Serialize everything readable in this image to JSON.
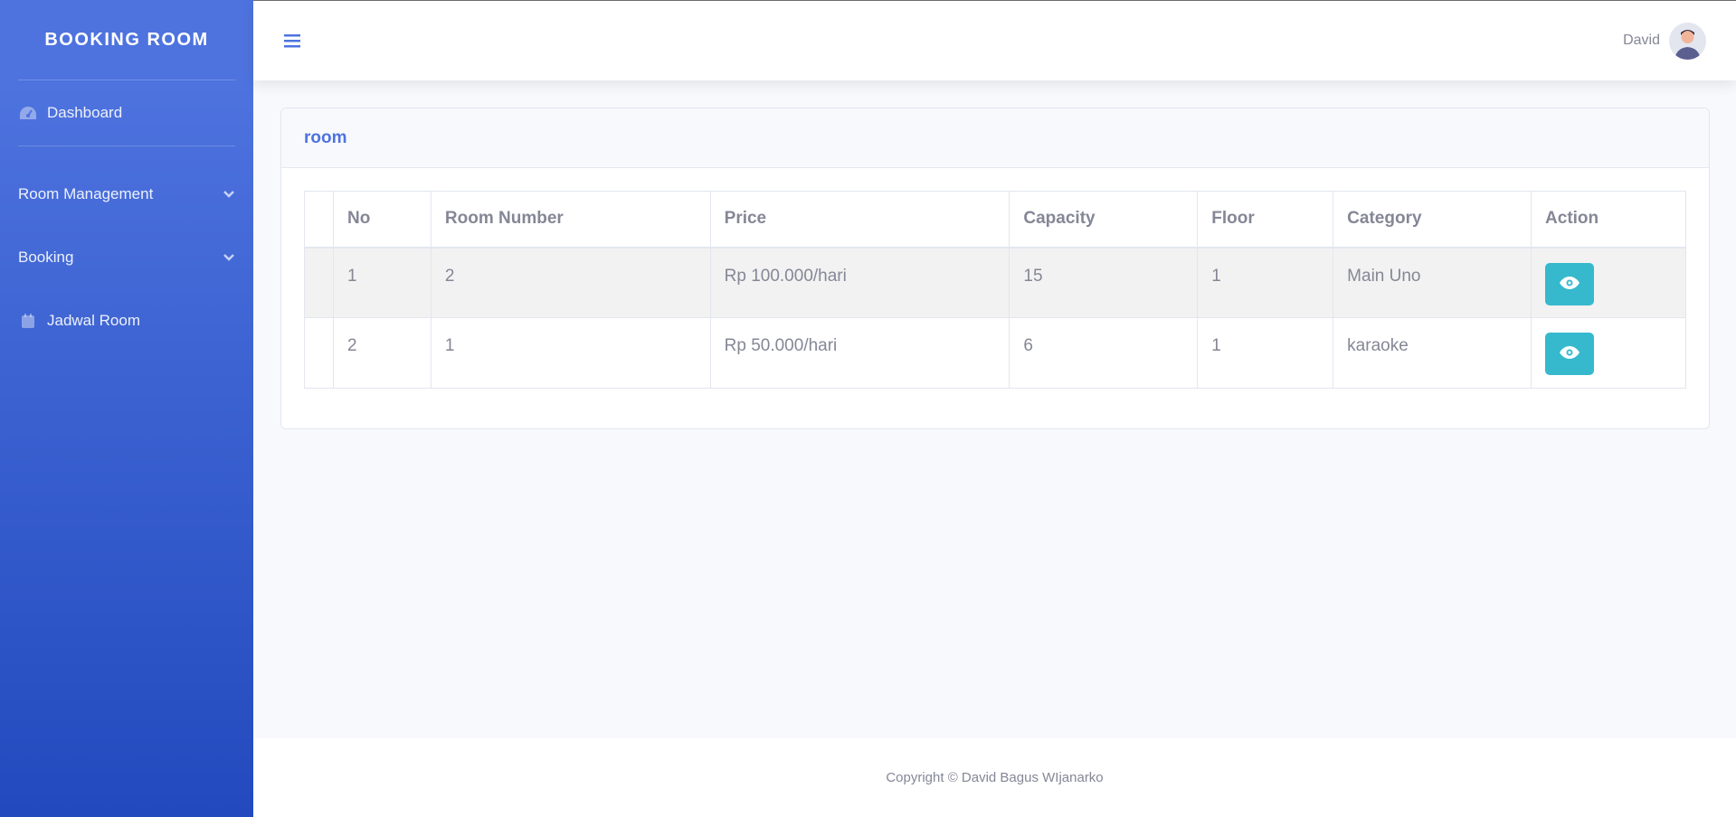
{
  "brand": {
    "title": "BOOKING ROOM"
  },
  "sidebar": {
    "items": [
      {
        "label": "Dashboard",
        "icon": "tachometer-icon"
      },
      {
        "label": "Room Management",
        "icon": "chevron-down-icon"
      },
      {
        "label": "Booking",
        "icon": "chevron-down-icon"
      },
      {
        "label": "Jadwal Room",
        "icon": "calendar-icon"
      }
    ]
  },
  "topbar": {
    "user_name": "David"
  },
  "card": {
    "title": "room"
  },
  "table": {
    "headers": [
      "",
      "No",
      "Room Number",
      "Price",
      "Capacity",
      "Floor",
      "Category",
      "Action"
    ],
    "rows": [
      {
        "no": "1",
        "room_number": "2",
        "price": "Rp 100.000/hari",
        "capacity": "15",
        "floor": "1",
        "category": "Main Uno"
      },
      {
        "no": "2",
        "room_number": "1",
        "price": "Rp 50.000/hari",
        "capacity": "6",
        "floor": "1",
        "category": "karaoke"
      }
    ]
  },
  "footer": {
    "text": "Copyright © David Bagus WIjanarko"
  },
  "colors": {
    "primary": "#4e73df",
    "info": "#36b9cc",
    "text": "#858796"
  }
}
